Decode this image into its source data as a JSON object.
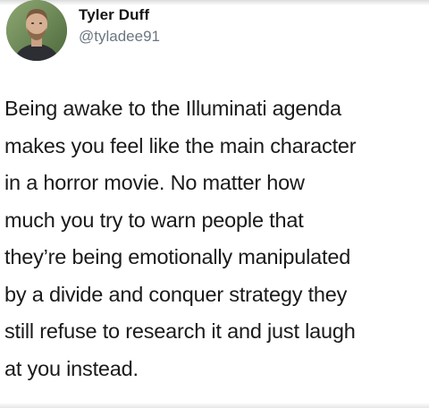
{
  "tweet": {
    "author": {
      "display_name": "Tyler Duff",
      "handle": "@tyladee91",
      "avatar": "avatar-photo"
    },
    "text_lines": [
      "Being awake to the Illuminati agenda",
      "makes you feel like the main character",
      "in a horror movie. No matter how",
      "much you try to warn people that",
      "they’re being emotionally manipulated",
      "by a divide and conquer strategy they",
      "still refuse to research it and just laugh",
      "at you instead."
    ]
  }
}
